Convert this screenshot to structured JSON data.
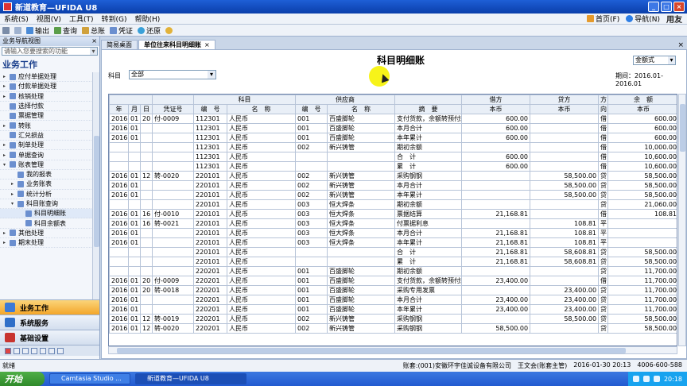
{
  "window": {
    "title": "新道教育—UFIDA U8",
    "min": "_",
    "max": "□",
    "close": "×"
  },
  "menu": {
    "items": [
      "系统(S)",
      "视图(V)",
      "工具(T)",
      "转到(G)",
      "帮助(H)"
    ],
    "home": "首页(F)",
    "nav": "导航(N)",
    "brand": "用友"
  },
  "toolbar": {
    "items": [
      "输出",
      "查询",
      "总账",
      "凭证",
      "还原"
    ]
  },
  "sidebar": {
    "header": "业务导航视图",
    "search_placeholder": "请输入您要搜索的功能",
    "section": "业务工作",
    "tree": [
      {
        "label": "应付单据处理",
        "arrow": "▸",
        "indent": 1
      },
      {
        "label": "付款单据处理",
        "arrow": "▸",
        "indent": 1
      },
      {
        "label": "核销处理",
        "arrow": "▸",
        "indent": 1
      },
      {
        "label": "选择付款",
        "arrow": "",
        "indent": 1
      },
      {
        "label": "票据管理",
        "arrow": "",
        "indent": 1
      },
      {
        "label": "转账",
        "arrow": "▸",
        "indent": 1
      },
      {
        "label": "汇兑损益",
        "arrow": "",
        "indent": 1
      },
      {
        "label": "制单处理",
        "arrow": "▸",
        "indent": 1
      },
      {
        "label": "单据查询",
        "arrow": "▸",
        "indent": 1
      },
      {
        "label": "账表管理",
        "arrow": "▾",
        "indent": 1
      },
      {
        "label": "我的报表",
        "arrow": "",
        "indent": 2
      },
      {
        "label": "业务账表",
        "arrow": "▸",
        "indent": 2
      },
      {
        "label": "统计分析",
        "arrow": "▸",
        "indent": 2
      },
      {
        "label": "科目账查询",
        "arrow": "▾",
        "indent": 2
      },
      {
        "label": "科目明细账",
        "arrow": "",
        "indent": 3,
        "selected": true
      },
      {
        "label": "科目余额表",
        "arrow": "",
        "indent": 3
      },
      {
        "label": "其他处理",
        "arrow": "▸",
        "indent": 1
      },
      {
        "label": "期末处理",
        "arrow": "▸",
        "indent": 1
      }
    ],
    "nav_buttons": [
      "业务工作",
      "系统服务",
      "基础设置"
    ]
  },
  "tabs": [
    {
      "label": "简易桌面",
      "active": false
    },
    {
      "label": "单位往来科目明细账",
      "active": true,
      "close": "×"
    }
  ],
  "tab_close_all": "×",
  "report": {
    "title": "科目明细账",
    "format": "金额式",
    "subject_label": "科目",
    "subject_value": "全部",
    "period": "期间：2016.01-2016.01"
  },
  "table": {
    "header1": [
      "",
      "",
      "",
      "",
      "科目",
      "供应商",
      "",
      "借方",
      "贷方",
      "方",
      "余　额"
    ],
    "header1_sub": [
      "年",
      "月",
      "日",
      "凭证号",
      "编　号",
      "名　称",
      "编　号",
      "名　称",
      "摘　要",
      "本币",
      "本币",
      "向",
      "本币"
    ],
    "rows": [
      [
        "2016",
        "01",
        "20",
        "付-0009",
        "112301",
        "人民币",
        "001",
        "百盛脚轮",
        "支付货款，余额转预付款",
        "600.00",
        "",
        "借",
        "600.00"
      ],
      [
        "2016",
        "01",
        "",
        "",
        "112301",
        "人民币",
        "001",
        "百盛脚轮",
        "本月合计",
        "600.00",
        "",
        "借",
        "600.00"
      ],
      [
        "2016",
        "01",
        "",
        "",
        "112301",
        "人民币",
        "001",
        "百盛脚轮",
        "本年累计",
        "600.00",
        "",
        "借",
        "600.00"
      ],
      [
        "",
        "",
        "",
        "",
        "112301",
        "人民币",
        "002",
        "新兴铸管",
        "期初余额",
        "",
        "",
        "借",
        "10,000.00"
      ],
      [
        "",
        "",
        "",
        "",
        "112301",
        "人民币",
        "",
        "",
        "合　计",
        "600.00",
        "",
        "借",
        "10,600.00"
      ],
      [
        "",
        "",
        "",
        "",
        "112301",
        "人民币",
        "",
        "",
        "累　计",
        "600.00",
        "",
        "借",
        "10,600.00"
      ],
      [
        "2016",
        "01",
        "12",
        "转-0020",
        "220101",
        "人民币",
        "002",
        "新兴铸管",
        "采购钢钢",
        "",
        "58,500.00",
        "贷",
        "58,500.00"
      ],
      [
        "2016",
        "01",
        "",
        "",
        "220101",
        "人民币",
        "002",
        "新兴铸管",
        "本月合计",
        "",
        "58,500.00",
        "贷",
        "58,500.00"
      ],
      [
        "2016",
        "01",
        "",
        "",
        "220101",
        "人民币",
        "002",
        "新兴铸管",
        "本年累计",
        "",
        "58,500.00",
        "贷",
        "58,500.00"
      ],
      [
        "",
        "",
        "",
        "",
        "220101",
        "人民币",
        "003",
        "恒大焊条",
        "期初余额",
        "",
        "",
        "贷",
        "21,060.00"
      ],
      [
        "2016",
        "01",
        "16",
        "付-0010",
        "220101",
        "人民币",
        "003",
        "恒大焊条",
        "票据结算",
        "21,168.81",
        "",
        "借",
        "108.81"
      ],
      [
        "2016",
        "01",
        "16",
        "转-0021",
        "220101",
        "人民币",
        "003",
        "恒大焊条",
        "付票据利息",
        "",
        "108.81",
        "平",
        ""
      ],
      [
        "2016",
        "01",
        "",
        "",
        "220101",
        "人民币",
        "003",
        "恒大焊条",
        "本月合计",
        "21,168.81",
        "108.81",
        "平",
        ""
      ],
      [
        "2016",
        "01",
        "",
        "",
        "220101",
        "人民币",
        "003",
        "恒大焊条",
        "本年累计",
        "21,168.81",
        "108.81",
        "平",
        ""
      ],
      [
        "",
        "",
        "",
        "",
        "220101",
        "人民币",
        "",
        "",
        "合　计",
        "21,168.81",
        "58,608.81",
        "贷",
        "58,500.00"
      ],
      [
        "",
        "",
        "",
        "",
        "220101",
        "人民币",
        "",
        "",
        "累　计",
        "21,168.81",
        "58,608.81",
        "贷",
        "58,500.00"
      ],
      [
        "",
        "",
        "",
        "",
        "220201",
        "人民币",
        "001",
        "百盛脚轮",
        "期初余额",
        "",
        "",
        "贷",
        "11,700.00"
      ],
      [
        "2016",
        "01",
        "20",
        "付-0009",
        "220201",
        "人民币",
        "001",
        "百盛脚轮",
        "支付货款，余额转预付款",
        "23,400.00",
        "",
        "借",
        "11,700.00"
      ],
      [
        "2016",
        "01",
        "20",
        "转-0018",
        "220201",
        "人民币",
        "001",
        "百盛脚轮",
        "采购专用发票",
        "",
        "23,400.00",
        "贷",
        "11,700.00"
      ],
      [
        "2016",
        "01",
        "",
        "",
        "220201",
        "人民币",
        "001",
        "百盛脚轮",
        "本月合计",
        "23,400.00",
        "23,400.00",
        "贷",
        "11,700.00"
      ],
      [
        "2016",
        "01",
        "",
        "",
        "220201",
        "人民币",
        "001",
        "百盛脚轮",
        "本年累计",
        "23,400.00",
        "23,400.00",
        "贷",
        "11,700.00"
      ],
      [
        "2016",
        "01",
        "12",
        "转-0019",
        "220201",
        "人民币",
        "002",
        "新兴铸管",
        "采购钢钢",
        "",
        "58,500.00",
        "贷",
        "58,500.00"
      ],
      [
        "2016",
        "01",
        "12",
        "转-0020",
        "220201",
        "人民币",
        "002",
        "新兴铸管",
        "采购钢钢",
        "58,500.00",
        "",
        "贷",
        "58,500.00"
      ]
    ]
  },
  "status": {
    "ready": "就绪",
    "account": "账套:(001)安徽环宇佳诚设备有限公司",
    "user": "王文会(账套主管)",
    "datetime": "2016-01-30 20:13",
    "phone": "4006-600-588"
  },
  "taskbar": {
    "start": "开始",
    "tasks": [
      "Camtasia Studio ...",
      "新道教育—UFIDA U8"
    ],
    "clock": "20:18"
  }
}
